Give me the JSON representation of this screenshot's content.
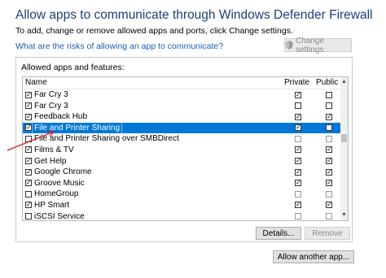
{
  "header": {
    "title": "Allow apps to communicate through Windows Defender Firewall",
    "subtitle": "To add, change or remove allowed apps and ports, click Change settings.",
    "risk_link": "What are the risks of allowing an app to communicate?",
    "change_settings_label": "Change settings"
  },
  "allowed_group": {
    "label": "Allowed apps and features:",
    "columns": {
      "name": "Name",
      "private": "Private",
      "public": "Public"
    },
    "rows": [
      {
        "name": "Far Cry 3",
        "enabled": true,
        "private": true,
        "public": false
      },
      {
        "name": "Far Cry 3",
        "enabled": true,
        "private": false,
        "public": false
      },
      {
        "name": "Feedback Hub",
        "enabled": true,
        "private": true,
        "public": true
      },
      {
        "name": "File and Printer Sharing",
        "enabled": true,
        "private": true,
        "public": false,
        "selected": true
      },
      {
        "name": "File and Printer Sharing over SMBDirect",
        "enabled": false,
        "private": false,
        "public": false
      },
      {
        "name": "Films & TV",
        "enabled": true,
        "private": true,
        "public": true
      },
      {
        "name": "Get Help",
        "enabled": true,
        "private": true,
        "public": true
      },
      {
        "name": "Google Chrome",
        "enabled": true,
        "private": true,
        "public": true
      },
      {
        "name": "Groove Music",
        "enabled": true,
        "private": true,
        "public": true
      },
      {
        "name": "HomeGroup",
        "enabled": false,
        "private": false,
        "public": false
      },
      {
        "name": "HP Smart",
        "enabled": true,
        "private": true,
        "public": true
      },
      {
        "name": "iSCSI Service",
        "enabled": false,
        "private": false,
        "public": false
      }
    ],
    "details_label": "Details...",
    "remove_label": "Remove"
  },
  "allow_another_label": "Allow another app...",
  "colors": {
    "title": "#1e3f78",
    "link": "#1a5fb4",
    "selection": "#0078d7",
    "annotation_arrow": "#d42020"
  },
  "icons": {
    "change_settings": "shield-icon",
    "scroll_up": "chevron-up-icon",
    "scroll_down": "chevron-down-icon",
    "annotation": "red-arrow-icon"
  }
}
